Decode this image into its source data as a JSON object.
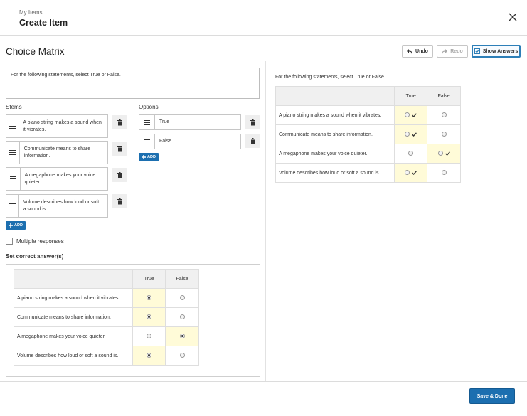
{
  "header": {
    "breadcrumb": "My Items",
    "title": "Create Item"
  },
  "question_type": "Choice Matrix",
  "toolbar": {
    "undo": "Undo",
    "redo": "Redo",
    "show_answers": "Show Answers"
  },
  "stimulus": "For the following statements, select True or False.",
  "stems_label": "Stems",
  "options_label": "Options",
  "stems": [
    "A piano string makes a sound when it vibrates.",
    "Communicate means to share information.",
    "A megaphone makes your voice quieter.",
    "Volume describes how loud or soft a sound is."
  ],
  "options": [
    "True",
    "False"
  ],
  "add_label": "ADD",
  "multiple_responses_label": "Multiple responses",
  "set_correct_label": "Set correct answer(s)",
  "correct_answers": [
    "True",
    "True",
    "False",
    "True"
  ],
  "footer": {
    "save_done": "Save & Done"
  },
  "colors": {
    "accent": "#1c6fb0",
    "highlight": "#fffbd8"
  },
  "icons": [
    "close-icon",
    "undo-icon",
    "redo-icon",
    "checkbox-icon",
    "drag-handle-icon",
    "trash-icon",
    "plus-icon",
    "check-icon"
  ]
}
